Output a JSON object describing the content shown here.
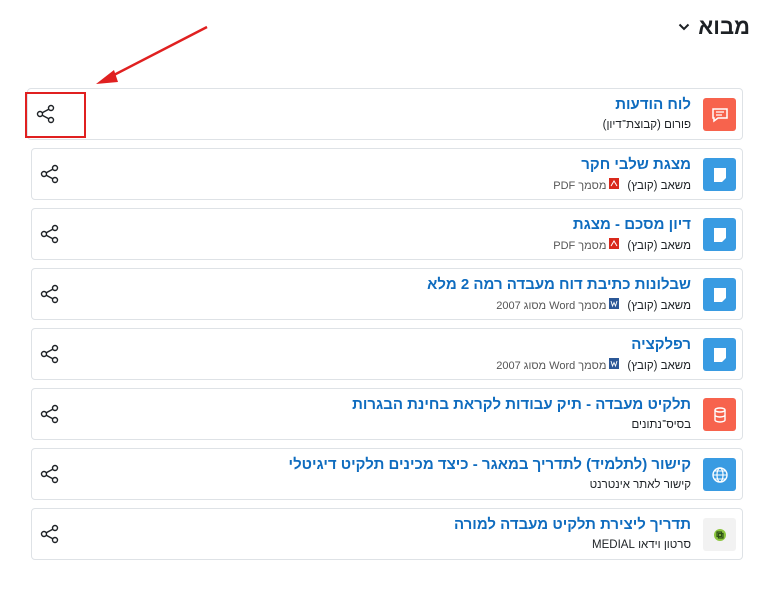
{
  "section": {
    "title": "מבוא"
  },
  "items": [
    {
      "title": "לוח הודעות",
      "type": "פורום (קבוצת־דיון)",
      "file": "",
      "icon": "forum-icon",
      "color": "#f7634d"
    },
    {
      "title": "מצגת שלבי חקר",
      "type": "משאב (קובץ)",
      "file": "מסמך PDF",
      "fileicon": "pdf-file-icon",
      "icon": "file-resource-icon",
      "color": "#399be2"
    },
    {
      "title": "דיון מסכם - מצגת",
      "type": "משאב (קובץ)",
      "file": "מסמך PDF",
      "fileicon": "pdf-file-icon",
      "icon": "file-resource-icon",
      "color": "#399be2"
    },
    {
      "title": "שבלונות כתיבת דוח מעבדה רמה 2 מלא",
      "type": "משאב (קובץ)",
      "file": "מסמך Word מסוג 2007",
      "fileicon": "word-file-icon",
      "icon": "file-resource-icon",
      "color": "#399be2"
    },
    {
      "title": "רפלקציה",
      "type": "משאב (קובץ)",
      "file": "מסמך Word מסוג 2007",
      "fileicon": "word-file-icon",
      "icon": "file-resource-icon",
      "color": "#399be2"
    },
    {
      "title": "תלקיט מעבדה - תיק עבודות לקראת בחינת הבגרות",
      "type": "בסיס־נתונים",
      "file": "",
      "icon": "database-icon",
      "color": "#f7634d"
    },
    {
      "title": "קישור (לתלמיד) לתדריך במאגר - כיצד מכינים תלקיט דיגיטלי",
      "type": "קישור לאתר אינטרנט",
      "file": "",
      "icon": "globe-icon",
      "color": "#399be2"
    },
    {
      "title": "תדריך ליצירת תלקיט מעבדה למורה",
      "type": "סרטון וידאו MEDIAL",
      "file": "",
      "icon": "medial-video-icon",
      "color": "#f2f2f2"
    }
  ],
  "colors": {
    "title": "#0f6cbf",
    "highlight": "#e02020",
    "border": "#dee2e6"
  }
}
